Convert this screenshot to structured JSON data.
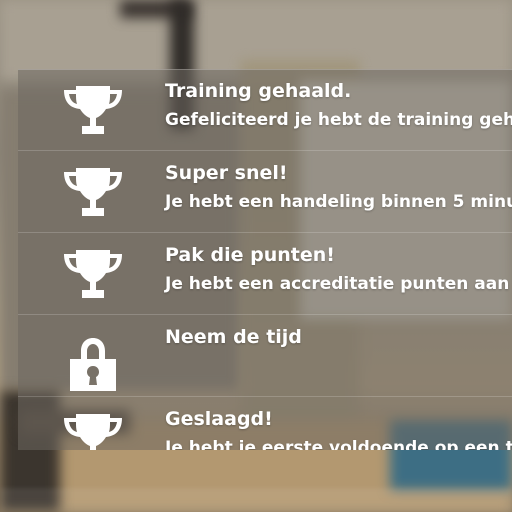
{
  "achievements": [
    {
      "title": "Training gehaald.",
      "description": "Gefeliciteerd je hebt de training geh",
      "icon": "trophy-icon",
      "unlocked": true
    },
    {
      "title": "Super snel!",
      "description": "Je hebt een handeling binnen 5 minu",
      "icon": "trophy-icon",
      "unlocked": true
    },
    {
      "title": "Pak die punten!",
      "description": "Je hebt een accreditatie punten aan",
      "icon": "trophy-icon",
      "unlocked": true
    },
    {
      "title": "Neem de tijd",
      "description": "",
      "icon": "lock-icon",
      "unlocked": false
    },
    {
      "title": "Geslaagd!",
      "description": "Je hebt je eerste voldoende op een t",
      "icon": "trophy-icon",
      "unlocked": true
    }
  ],
  "colors": {
    "text": "#ffffff",
    "panel": "rgba(110,104,96,0.55)",
    "icon": "#ffffff"
  }
}
